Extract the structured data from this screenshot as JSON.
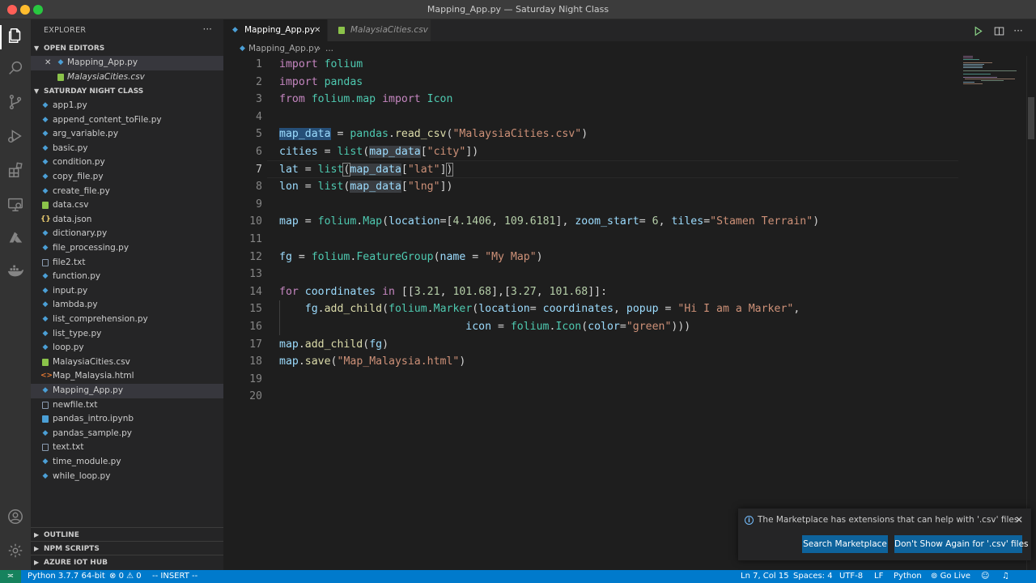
{
  "window": {
    "title": "Mapping_App.py — Saturday Night Class"
  },
  "colors": {
    "accent": "#007acc",
    "button": "#0e639c",
    "background": "#1e1e1e"
  },
  "activity_bar": [
    "files-icon",
    "search-icon",
    "source-control-icon",
    "run-debug-icon",
    "extensions-icon",
    "remote-explorer-icon",
    "azure-icon",
    "docker-icon",
    "account-icon",
    "manage-gear-icon"
  ],
  "sidebar": {
    "title": "EXPLORER",
    "more": "···",
    "open_editors": {
      "header": "OPEN EDITORS",
      "items": [
        {
          "name": "Mapping_App.py",
          "type": "py"
        },
        {
          "name": "MalaysiaCities.csv",
          "type": "csv"
        }
      ]
    },
    "folder": {
      "header": "SATURDAY NIGHT CLASS",
      "files": [
        {
          "name": "app1.py",
          "type": "py"
        },
        {
          "name": "append_content_toFile.py",
          "type": "py"
        },
        {
          "name": "arg_variable.py",
          "type": "py"
        },
        {
          "name": "basic.py",
          "type": "py"
        },
        {
          "name": "condition.py",
          "type": "py"
        },
        {
          "name": "copy_file.py",
          "type": "py"
        },
        {
          "name": "create_file.py",
          "type": "py"
        },
        {
          "name": "data.csv",
          "type": "csv"
        },
        {
          "name": "data.json",
          "type": "json"
        },
        {
          "name": "dictionary.py",
          "type": "py"
        },
        {
          "name": "file_processing.py",
          "type": "py"
        },
        {
          "name": "file2.txt",
          "type": "txt"
        },
        {
          "name": "function.py",
          "type": "py"
        },
        {
          "name": "input.py",
          "type": "py"
        },
        {
          "name": "lambda.py",
          "type": "py"
        },
        {
          "name": "list_comprehension.py",
          "type": "py"
        },
        {
          "name": "list_type.py",
          "type": "py"
        },
        {
          "name": "loop.py",
          "type": "py"
        },
        {
          "name": "MalaysiaCities.csv",
          "type": "csv"
        },
        {
          "name": "Map_Malaysia.html",
          "type": "html"
        },
        {
          "name": "Mapping_App.py",
          "type": "py"
        },
        {
          "name": "newfile.txt",
          "type": "txt"
        },
        {
          "name": "pandas_intro.ipynb",
          "type": "ipynb"
        },
        {
          "name": "pandas_sample.py",
          "type": "py"
        },
        {
          "name": "text.txt",
          "type": "txt"
        },
        {
          "name": "time_module.py",
          "type": "py"
        },
        {
          "name": "while_loop.py",
          "type": "py"
        }
      ]
    },
    "bottom_sections": [
      "OUTLINE",
      "NPM SCRIPTS",
      "AZURE IOT HUB"
    ]
  },
  "tabs": [
    {
      "label": "Mapping_App.py",
      "active": true
    },
    {
      "label": "MalaysiaCities.csv",
      "active": false
    }
  ],
  "breadcrumb": {
    "file": "Mapping_App.py",
    "separator": "›",
    "rest": "..."
  },
  "editor": {
    "line_numbers": [
      "1",
      "2",
      "3",
      "4",
      "5",
      "6",
      "7",
      "8",
      "9",
      "10",
      "11",
      "12",
      "13",
      "14",
      "15",
      "16",
      "17",
      "18",
      "19",
      "20"
    ],
    "current_line": 7
  },
  "notification": {
    "message": "The Marketplace has extensions that can help with '.csv' files",
    "buttons": [
      "Search Marketplace",
      "Don't Show Again for '.csv' files"
    ]
  },
  "status_bar": {
    "interpreter": "Python 3.7.7 64-bit",
    "errors": "0",
    "warnings": "0",
    "mode": "-- INSERT --",
    "position": "Ln 7, Col 15",
    "spaces": "Spaces: 4",
    "encoding": "UTF-8",
    "eol": "LF",
    "language": "Python",
    "go_live": "Go Live"
  },
  "manage_badge": "1"
}
